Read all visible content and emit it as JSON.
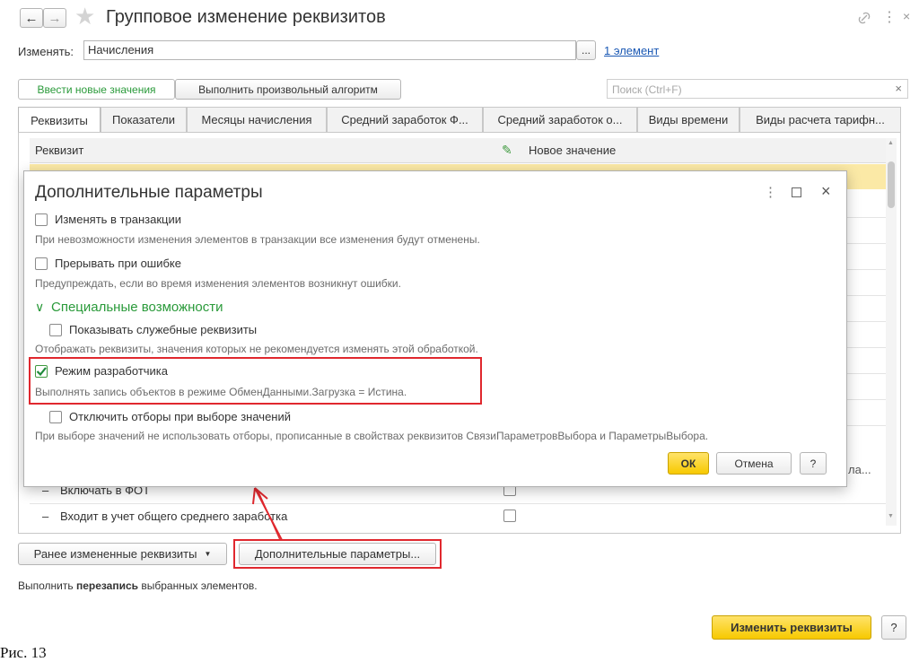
{
  "window": {
    "title": "Групповое изменение реквизитов",
    "change_label": "Изменять:",
    "change_value": "Начисления",
    "ellipsis": "...",
    "elements_link": "1 элемент"
  },
  "toolbar": {
    "tab_new_values": "Ввести новые значения",
    "tab_algorithm": "Выполнить произвольный алгоритм",
    "search_placeholder": "Поиск (Ctrl+F)",
    "clear": "×"
  },
  "tabs": [
    {
      "label": "Реквизиты"
    },
    {
      "label": "Показатели"
    },
    {
      "label": "Месяцы начисления"
    },
    {
      "label": "Средний заработок Ф..."
    },
    {
      "label": "Средний заработок о..."
    },
    {
      "label": "Виды времени"
    },
    {
      "label": "Виды расчета тарифн..."
    }
  ],
  "table": {
    "col_attribute": "Реквизит",
    "col_new_value": "Новое значение",
    "rows": [
      {
        "label": "Включать в ФОТ"
      },
      {
        "label": "Входит в учет общего среднего заработка"
      }
    ],
    "partial_text": "ла..."
  },
  "dialog": {
    "title": "Дополнительные параметры",
    "options": [
      {
        "label": "Изменять в транзакции",
        "note": "При невозможности изменения элементов в транзакции все изменения будут отменены.",
        "checked": false
      },
      {
        "label": "Прерывать при ошибке",
        "note": "Предупреждать, если во время изменения элементов возникнут ошибки.",
        "checked": false
      }
    ],
    "section_title": "Специальные возможности",
    "special_options": [
      {
        "label": "Показывать служебные реквизиты",
        "note": "Отображать реквизиты, значения которых не рекомендуется изменять этой обработкой.",
        "checked": false
      },
      {
        "label": "Режим разработчика",
        "note": "Выполнять запись объектов в режиме ОбменДанными.Загрузка = Истина.",
        "checked": true
      },
      {
        "label": "Отключить отборы при выборе значений",
        "note": "При выборе значений не использовать отборы, прописанные в свойствах реквизитов СвязиПараметровВыбора и ПараметрыВыбора.",
        "checked": false
      }
    ],
    "ok": "ОК",
    "cancel": "Отмена",
    "help": "?"
  },
  "bottom": {
    "prev_changed": "Ранее измененные реквизиты",
    "extra_params": "Дополнительные параметры...",
    "info_prefix": "Выполнить ",
    "info_bold": "перезапись",
    "info_suffix": " выбранных элементов.",
    "change_button": "Изменить реквизиты",
    "help": "?"
  },
  "caption": "Рис. 13"
}
